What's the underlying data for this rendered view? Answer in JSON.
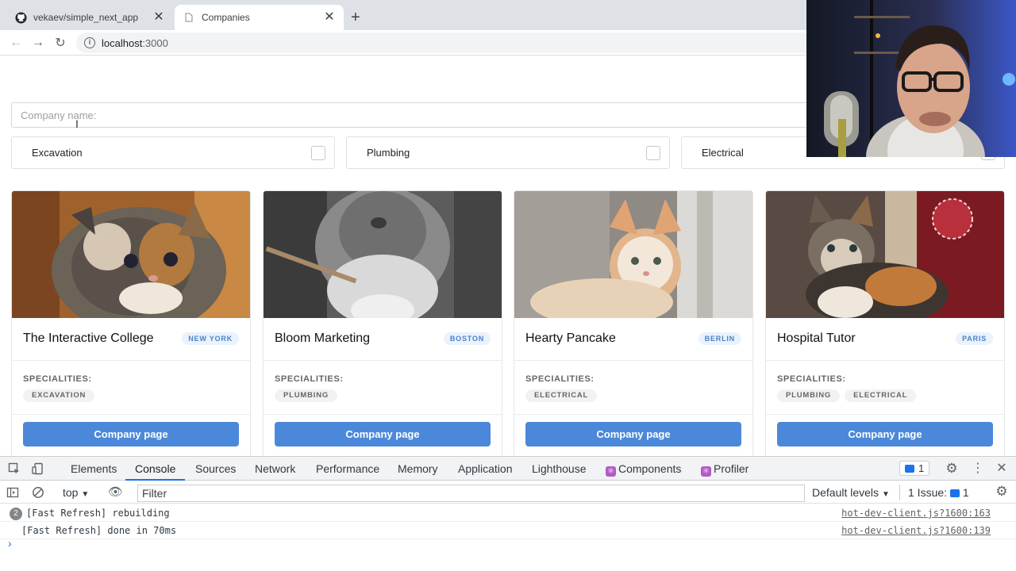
{
  "browser": {
    "tabs": [
      {
        "title": "vekaev/simple_next_app",
        "icon": "github-icon"
      },
      {
        "title": "Companies",
        "icon": "page-icon"
      }
    ],
    "address": {
      "host": "localhost",
      "port": ":3000"
    }
  },
  "page": {
    "search_placeholder": "Company name:",
    "filters": [
      {
        "label": "Excavation"
      },
      {
        "label": "Plumbing"
      },
      {
        "label": "Electrical"
      }
    ],
    "specialities_label": "SPECIALITIES:",
    "button_label": "Company page",
    "companies": [
      {
        "name": "The Interactive College",
        "city": "NEW YORK",
        "tags": [
          "EXCAVATION"
        ]
      },
      {
        "name": "Bloom Marketing",
        "city": "BOSTON",
        "tags": [
          "PLUMBING"
        ]
      },
      {
        "name": "Hearty Pancake",
        "city": "BERLIN",
        "tags": [
          "ELECTRICAL"
        ]
      },
      {
        "name": "Hospital Tutor",
        "city": "PARIS",
        "tags": [
          "PLUMBING",
          "ELECTRICAL"
        ]
      }
    ]
  },
  "devtools": {
    "tabs": [
      "Elements",
      "Console",
      "Sources",
      "Network",
      "Performance",
      "Memory",
      "Application",
      "Lighthouse",
      "Components",
      "Profiler"
    ],
    "messages_badge": "1",
    "context": "top",
    "filter_placeholder": "Filter",
    "levels": "Default levels",
    "issues": "1 Issue:",
    "issues_count": "1",
    "console": [
      {
        "count": "2",
        "text": "[Fast Refresh] rebuilding",
        "source": "hot-dev-client.js?1600:163"
      },
      {
        "count": "",
        "text": "[Fast Refresh] done in 70ms",
        "source": "hot-dev-client.js?1600:139"
      }
    ]
  }
}
